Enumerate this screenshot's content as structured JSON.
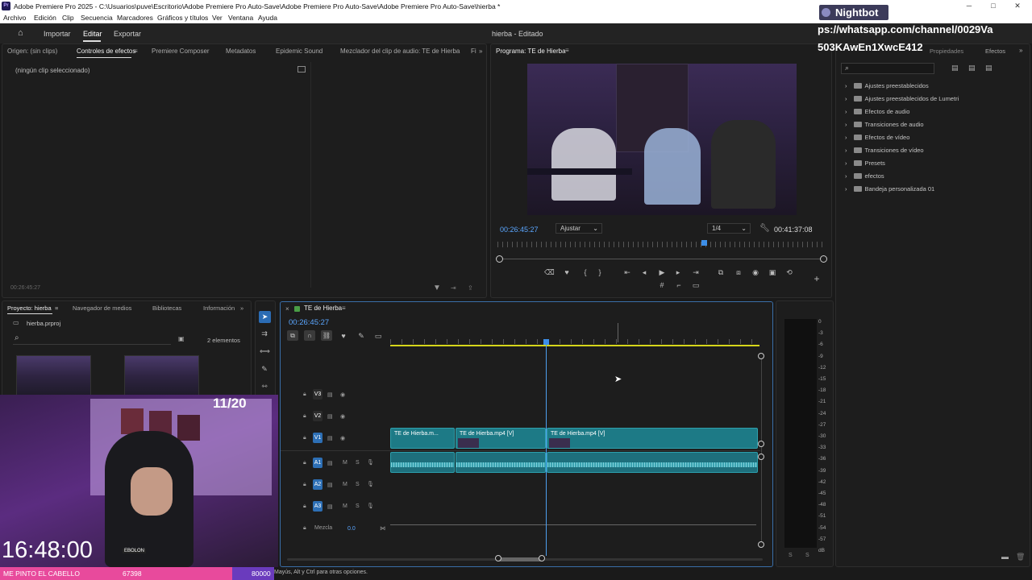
{
  "window": {
    "title": "Adobe Premiere Pro 2025 - C:\\Usuarios\\puve\\Escritorio\\Adobe Premiere Pro Auto-Save\\Adobe Premiere Pro Auto-Save\\Adobe Premiere Pro Auto-Save\\hierba *",
    "logo": "Pr"
  },
  "menu": [
    "Archivo",
    "Edición",
    "Clip",
    "Secuencia",
    "Marcadores",
    "Gráficos y títulos",
    "Ver",
    "Ventana",
    "Ayuda"
  ],
  "workspace": {
    "import": "Importar",
    "edit": "Editar",
    "export": "Exportar",
    "project_status": "hierba - Editado"
  },
  "source_panel": {
    "tabs": [
      "Origen: (sin clips)",
      "Controles de efectos",
      "Premiere Composer",
      "Metadatos",
      "Epidemic Sound",
      "Mezclador del clip de audio: TE de Hierba",
      "Fi"
    ],
    "empty_text": "(ningún clip seleccionado)",
    "timecode": "00:26:45:27"
  },
  "program_monitor": {
    "title": "Programa: TE de Hierba",
    "timecode": "00:26:45:27",
    "fit": "Ajustar",
    "resolution": "1/4",
    "duration": "00:41:37:08",
    "playhead_fraction": 0.62
  },
  "effects_panel": {
    "tab_label": "Efectos",
    "tab_propiedades": "Propiedades",
    "items": [
      "Ajustes preestablecidos",
      "Ajustes preestablecidos de Lumetri",
      "Efectos de audio",
      "Transiciones de audio",
      "Efectos de vídeo",
      "Transiciones de vídeo",
      "Presets",
      "efectos",
      "Bandeja personalizada 01"
    ]
  },
  "project_panel": {
    "tabs": [
      "Proyecto: hierba",
      "Navegador de medios",
      "Bibliotecas",
      "Información"
    ],
    "file": "hierba.prproj",
    "count": "2 elementos"
  },
  "timeline": {
    "sequence": "TE de Hierba",
    "timecode": "00:26:45:27",
    "tracks": {
      "video": [
        "V3",
        "V2",
        "V1"
      ],
      "audio": [
        "A1",
        "A2",
        "A3"
      ],
      "mix_label": "Mezcla",
      "mix_value": "0.0",
      "m": "M",
      "s": "S"
    },
    "clips": [
      {
        "label": "TE de Hierba.m..."
      },
      {
        "label": "TE de Hierba.mp4 [V]"
      },
      {
        "label": "TE de Hierba.mp4 [V]"
      }
    ]
  },
  "meter": {
    "ticks": [
      "0",
      "-3",
      "-6",
      "-9",
      "-12",
      "-15",
      "-18",
      "-21",
      "-24",
      "-27",
      "-30",
      "-33",
      "-36",
      "-39",
      "-42",
      "-45",
      "-48",
      "-51",
      "-54",
      "-57",
      "dB"
    ],
    "s_left": "S",
    "s_right": "S"
  },
  "status": {
    "hint": "Mayús, Alt y Ctrl para otras opciones."
  },
  "overlay": {
    "nightbot": "Nightbot",
    "url_line1": "ps://whatsapp.com/channel/0029Va",
    "url_line2": "503KAwEn1XwcE412",
    "counter": "11/20",
    "clock": "16:48:00",
    "bar_text": "ME PINTO EL CABELLO",
    "bar_points": "67398",
    "bar_goal": "80000",
    "cap_text": "EBOLON"
  },
  "colors": {
    "accent": "#2d8ceb",
    "clip": "#1d7a86",
    "timeline_yellow": "#d6d61a",
    "pink_bar": "#e84a9c",
    "purple_bar": "#6a3bbd"
  }
}
